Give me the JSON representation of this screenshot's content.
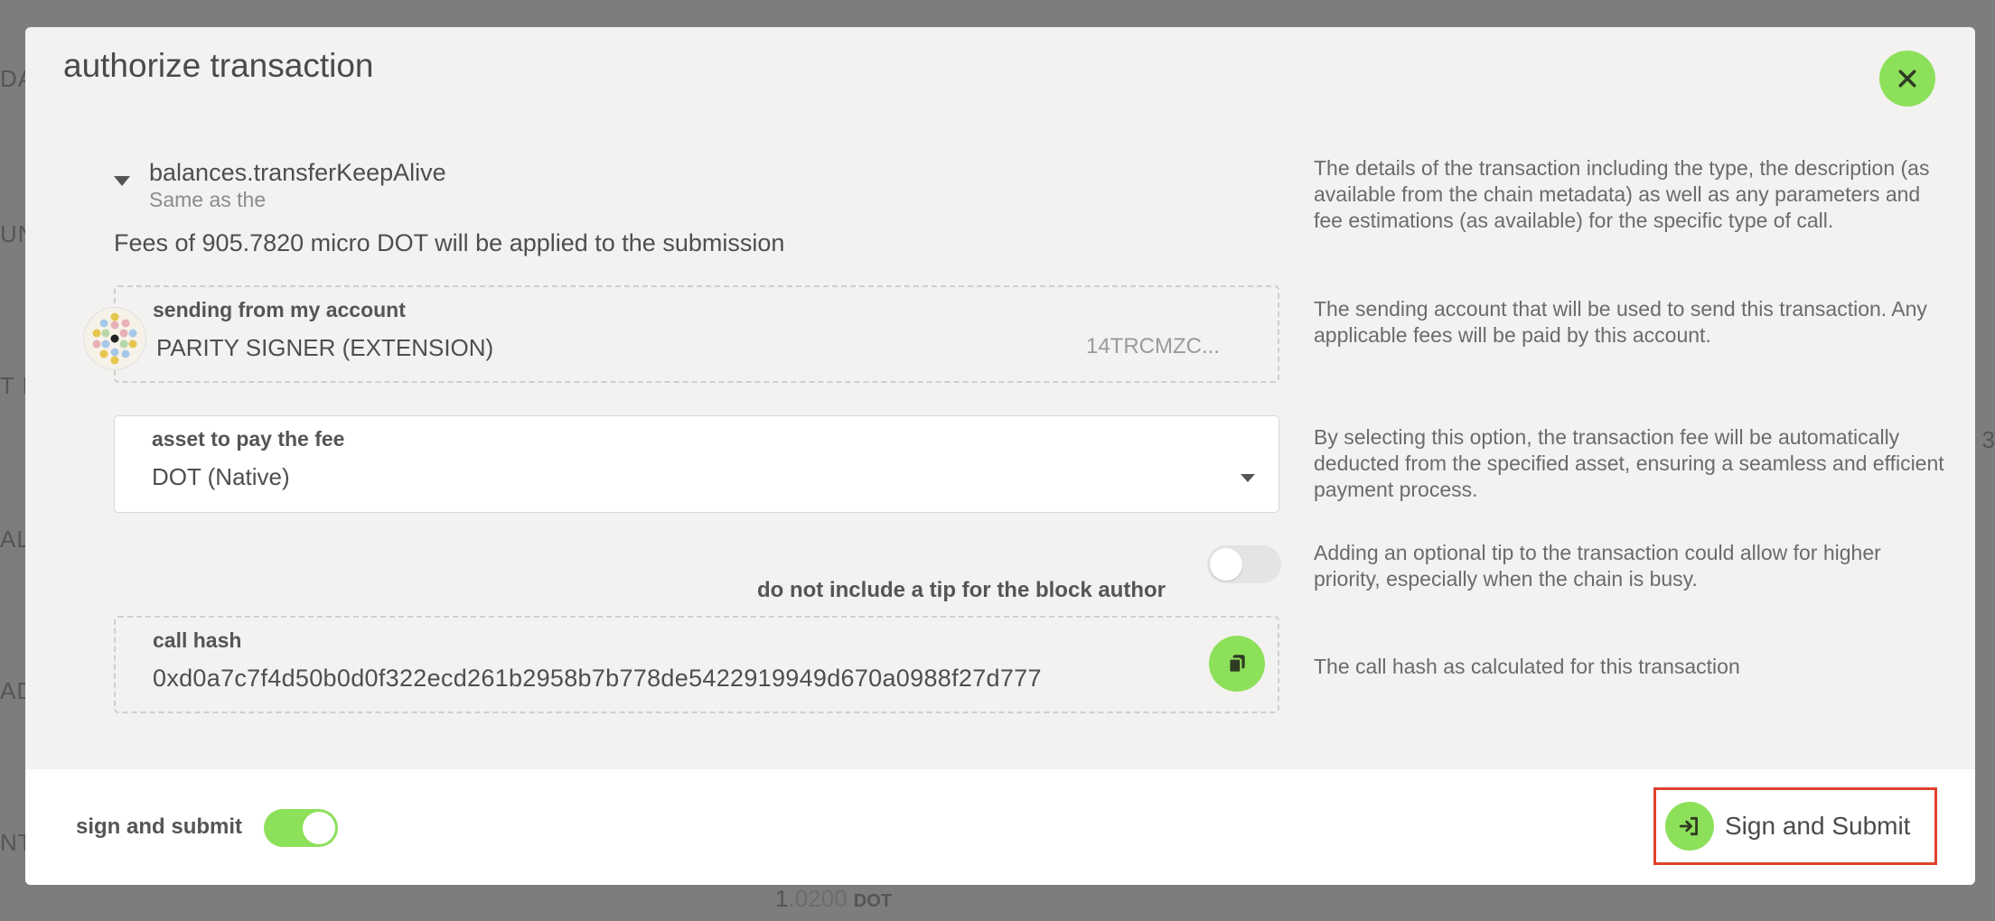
{
  "background": {
    "left_fragments": [
      "DA",
      "UN",
      "T D",
      "ALL",
      "ADI",
      "NT"
    ],
    "right_fragment": "3",
    "bottom_amount_int": "1",
    "bottom_amount_dec": ".0200",
    "bottom_unit": "DOT"
  },
  "modal": {
    "title": "authorize transaction",
    "close_icon": "close-icon"
  },
  "call": {
    "name": "balances.transferKeepAlive",
    "description": "Same as the",
    "fees": "Fees of 905.7820 micro DOT will be applied to the submission",
    "help": "The details of the transaction including the type, the description (as available from the chain metadata) as well as any parameters and fee estimations (as available) for the specific type of call."
  },
  "account": {
    "label": "sending from my account",
    "name": "PARITY SIGNER (EXTENSION)",
    "address": "14TRCMZC...",
    "help": "The sending account that will be used to send this transaction. Any applicable fees will be paid by this account."
  },
  "fee_asset": {
    "label": "asset to pay the fee",
    "value": "DOT (Native)",
    "help": "By selecting this option, the transaction fee will be automatically deducted from the specified asset, ensuring a seamless and efficient payment process."
  },
  "tip": {
    "label": "do not include a tip for the block author",
    "enabled": false,
    "help": "Adding an optional tip to the transaction could allow for higher priority, especially when the chain is busy."
  },
  "call_hash": {
    "label": "call hash",
    "value": "0xd0a7c7f4d50b0d0f322ecd261b2958b7b778de5422919949d670a0988f27d777",
    "help": "The call hash as calculated for this transaction"
  },
  "footer": {
    "toggle_label": "sign and submit",
    "toggle_on": true,
    "submit_label": "Sign and Submit"
  },
  "colors": {
    "accent": "#8de05a",
    "highlight_border": "#e0412a",
    "modal_bg": "#f3f2f1"
  }
}
